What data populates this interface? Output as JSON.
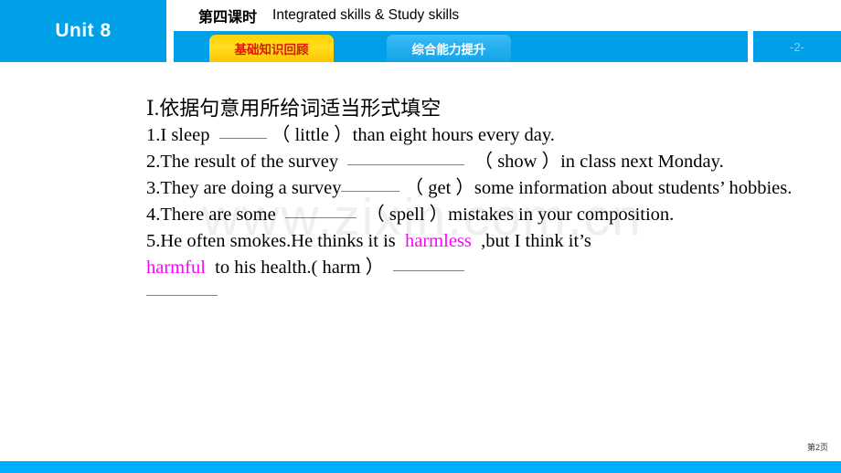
{
  "header": {
    "unit_label": "Unit 8",
    "title_cn": "第四课时",
    "title_en": "Integrated skills & Study skills",
    "tabs": [
      {
        "label": "基础知识回顾",
        "state": "active"
      },
      {
        "label": "综合能力提升",
        "state": "inactive"
      }
    ],
    "page_indicator": "-2-"
  },
  "watermark": {
    "text": "www.zixin.com.cn"
  },
  "content": {
    "heading": "Ⅰ.依据句意用所给词适当形式填空",
    "questions": [
      {
        "number": "1.",
        "text_before": "I sleep",
        "blank": "b-sm",
        "text_after": "（ little ）than eight hours every day."
      },
      {
        "number": "2.",
        "text_before": "The result of the survey",
        "blank": "b-xl",
        "text_after": "（ show ）in class next Monday."
      },
      {
        "number": "3.",
        "text_before": "They are doing a survey",
        "blank": "b-md",
        "text_after": "（ get ）some information about students’  hobbies."
      },
      {
        "number": "4.",
        "text_before": "There are some",
        "blank": "b-lg",
        "text_after": "（ spell ）mistakes in your composition."
      },
      {
        "number": "5.",
        "text_before": "He often smokes.He thinks it is",
        "answer_1": "harmless",
        "text_mid": ",but I think it’s",
        "answer_2": "harmful",
        "text_after": "to his health.( harm ）"
      }
    ]
  },
  "footer": {
    "page_label": "第2页"
  },
  "colors": {
    "brand_blue": "#00A0E9",
    "footer_blue": "#00AEFF",
    "tab_active_yellow": "#FFD200",
    "tab_active_text": "#D91A00",
    "answer_magenta": "#FF00FF",
    "watermark_gray": "#EFEFEF"
  }
}
